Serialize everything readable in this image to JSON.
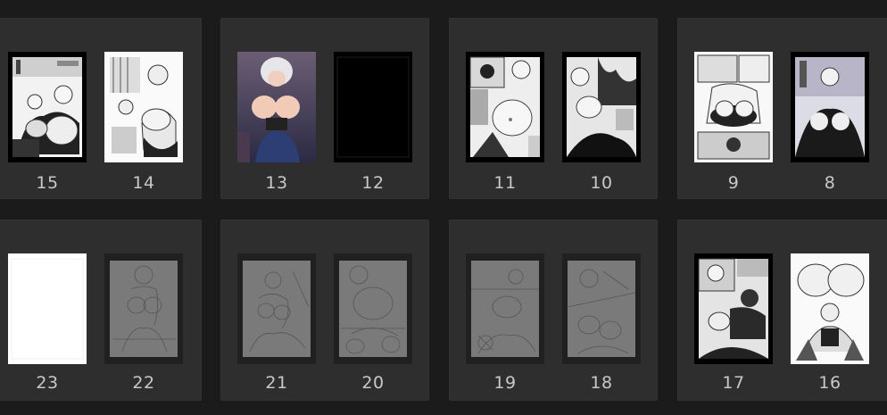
{
  "app": {
    "view": "page-thumbnail-spreads"
  },
  "row1": {
    "spreads": [
      {
        "pages": [
          {
            "number": "15",
            "kind": "manga-bw"
          },
          {
            "number": "14",
            "kind": "manga-bw-light"
          }
        ]
      },
      {
        "pages": [
          {
            "number": "13",
            "kind": "color-illustration"
          },
          {
            "number": "12",
            "kind": "blank-black"
          }
        ]
      },
      {
        "pages": [
          {
            "number": "11",
            "kind": "manga-bw"
          },
          {
            "number": "10",
            "kind": "manga-bw-dark"
          }
        ]
      },
      {
        "pages": [
          {
            "number": "9",
            "kind": "manga-bw-light"
          },
          {
            "number": "8",
            "kind": "manga-bw-dark"
          }
        ]
      }
    ]
  },
  "row2": {
    "spreads": [
      {
        "pages": [
          {
            "number": "23",
            "kind": "blank-white"
          },
          {
            "number": "22",
            "kind": "sketch"
          }
        ]
      },
      {
        "pages": [
          {
            "number": "21",
            "kind": "sketch"
          },
          {
            "number": "20",
            "kind": "sketch"
          }
        ]
      },
      {
        "pages": [
          {
            "number": "19",
            "kind": "sketch"
          },
          {
            "number": "18",
            "kind": "sketch"
          }
        ]
      },
      {
        "pages": [
          {
            "number": "17",
            "kind": "manga-bw-dark"
          },
          {
            "number": "16",
            "kind": "manga-bw-light"
          }
        ]
      }
    ]
  },
  "colors": {
    "background": "#1b1b1b",
    "spread_panel": "#2e2e2e",
    "label_text": "#c8c8c8",
    "sketch_fill": "#7a7a7a"
  }
}
